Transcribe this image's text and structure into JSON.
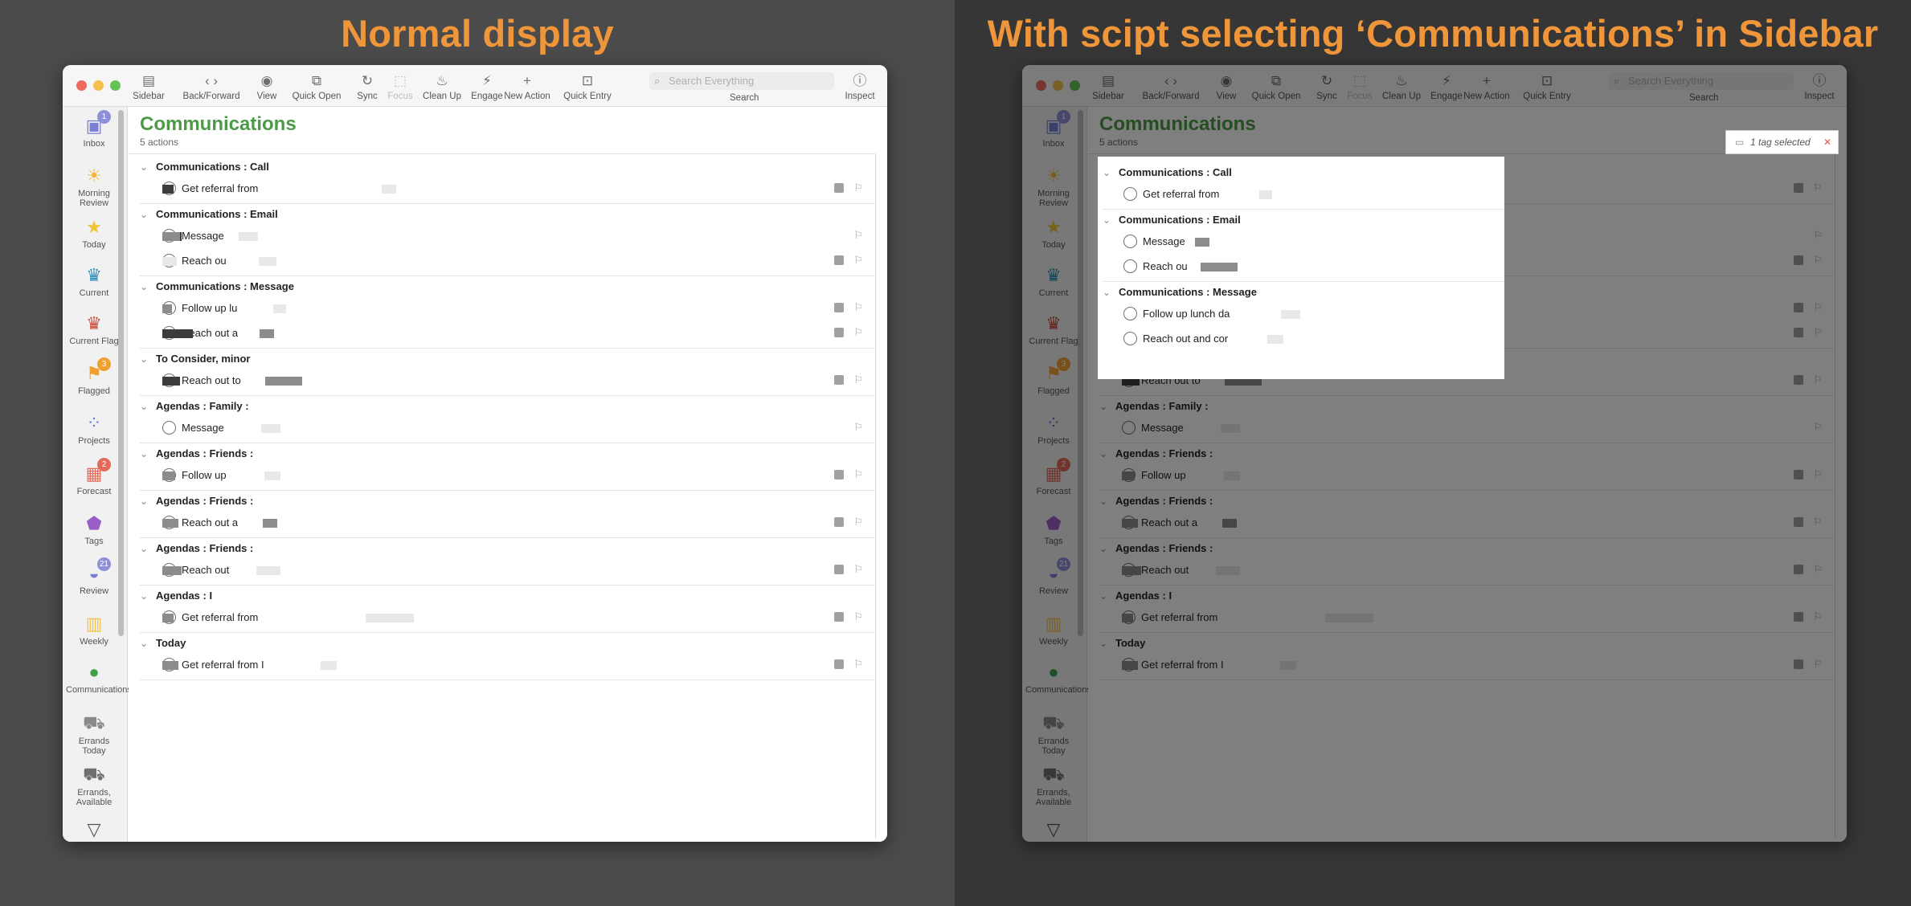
{
  "headings": {
    "left": "Normal display",
    "right": "With scipt selecting ‘Communications’ in Sidebar"
  },
  "toolbar": {
    "items": [
      {
        "label": "Sidebar",
        "icon": "sidebar-icon",
        "glyph": "▤"
      },
      {
        "label": "Back/Forward",
        "icon": "back-forward-icon",
        "glyph": "‹  ›"
      },
      {
        "label": "View",
        "icon": "eye-icon",
        "glyph": "◉"
      },
      {
        "label": "Quick Open",
        "icon": "quick-open-icon",
        "glyph": "⧉"
      },
      {
        "label": "Sync",
        "icon": "sync-icon",
        "glyph": "↻"
      },
      {
        "label": "Focus",
        "icon": "focus-icon",
        "glyph": "⬚"
      },
      {
        "label": "Clean Up",
        "icon": "clean-up-icon",
        "glyph": "♨"
      },
      {
        "label": "Engage",
        "icon": "engage-icon",
        "glyph": "⚡"
      },
      {
        "label": "New Action",
        "icon": "plus-icon",
        "glyph": "+"
      },
      {
        "label": "Quick Entry",
        "icon": "tray-icon",
        "glyph": "⊡"
      },
      {
        "label": "Inspect",
        "icon": "info-icon",
        "glyph": "ⓘ"
      }
    ],
    "search_placeholder": "Search Everything",
    "search_label": "Search"
  },
  "sidebar": {
    "items": [
      {
        "label": "Inbox",
        "icon": "inbox-icon",
        "glyph": "▣",
        "color": "#7a7fd6",
        "badge": "1",
        "badge_color": "#8d8fd9"
      },
      {
        "label": "Morning Review",
        "icon": "sunrise-icon",
        "glyph": "☀",
        "color": "#f3b83a",
        "badge": "",
        "badge_color": ""
      },
      {
        "label": "Today",
        "icon": "star-icon",
        "glyph": "★",
        "color": "#f1c232",
        "badge": "",
        "badge_color": ""
      },
      {
        "label": "Current",
        "icon": "current-icon",
        "glyph": "♛",
        "color": "#2f8fb7",
        "badge": "",
        "badge_color": ""
      },
      {
        "label": "Current Flag",
        "icon": "flag-crown-icon",
        "glyph": "♛",
        "color": "#c94b3b",
        "badge": "",
        "badge_color": ""
      },
      {
        "label": "Flagged",
        "icon": "flag-icon",
        "glyph": "⚑",
        "color": "#f0a033",
        "badge": "3",
        "badge_color": "#f0a033"
      },
      {
        "label": "Projects",
        "icon": "projects-icon",
        "glyph": "⁘",
        "color": "#4b7bd4",
        "badge": "",
        "badge_color": ""
      },
      {
        "label": "Forecast",
        "icon": "forecast-icon",
        "glyph": "▦",
        "color": "#e46b5a",
        "badge": "2",
        "badge_color": "#e46b5a"
      },
      {
        "label": "Tags",
        "icon": "tag-icon",
        "glyph": "⬟",
        "color": "#9a5ec8",
        "badge": "",
        "badge_color": ""
      },
      {
        "label": "Review",
        "icon": "review-icon",
        "glyph": "◒",
        "color": "#7a7fd6",
        "badge": "21",
        "badge_color": "#8d8fd9"
      },
      {
        "label": "Weekly",
        "icon": "calendar-icon",
        "glyph": "▥",
        "color": "#f3c24a",
        "badge": "",
        "badge_color": ""
      },
      {
        "label": "Communications",
        "icon": "speech-bubble-icon",
        "glyph": "●",
        "color": "#3ea04a",
        "badge": "",
        "badge_color": ""
      },
      {
        "label": "Errands Today",
        "icon": "car-icon",
        "glyph": "⛟",
        "color": "#8a8a8a",
        "badge": "",
        "badge_color": ""
      },
      {
        "label": "Errands, Available",
        "icon": "car-icon",
        "glyph": "⛟",
        "color": "#6f6f6f",
        "badge": "",
        "badge_color": ""
      },
      {
        "label": "",
        "icon": "filter-icon",
        "glyph": "▽",
        "color": "#555555",
        "badge": "",
        "badge_color": ""
      }
    ]
  },
  "perspective": {
    "title": "Communications",
    "subtitle": "5 actions"
  },
  "groups": [
    {
      "header": "Communications : Call",
      "rows": [
        {
          "text": "Get referral from",
          "note": true
        }
      ]
    },
    {
      "header": "Communications : Email",
      "rows": [
        {
          "text": "Message",
          "note": false
        },
        {
          "text": "Reach ou",
          "note": true
        }
      ]
    },
    {
      "header": "Communications : Message",
      "rows": [
        {
          "text": "Follow up lu",
          "note": true
        },
        {
          "text": "Reach out a",
          "note": true
        }
      ]
    },
    {
      "header": "To Consider, minor",
      "rows": [
        {
          "text": "Reach out to",
          "note": true
        }
      ]
    },
    {
      "header": "Agendas : Family :",
      "rows": [
        {
          "text": "Message",
          "note": false
        }
      ]
    },
    {
      "header": "Agendas : Friends :",
      "rows": [
        {
          "text": "Follow up",
          "note": true
        }
      ]
    },
    {
      "header": "Agendas : Friends :",
      "rows": [
        {
          "text": "Reach out a",
          "note": true
        }
      ]
    },
    {
      "header": "Agendas : Friends :",
      "rows": [
        {
          "text": "Reach out",
          "note": true
        }
      ]
    },
    {
      "header": "Agendas : I",
      "rows": [
        {
          "text": "Get referral from",
          "note": true
        }
      ]
    },
    {
      "header": "Today",
      "rows": [
        {
          "text": "Get referral from I",
          "note": true
        }
      ]
    }
  ],
  "right_rows": [
    "Get referral from",
    "Message",
    "Reach ou",
    "Follow up lunch da",
    "Reach out and cor"
  ],
  "tag_chip": "1 tag selected",
  "colors": {
    "heading": "#f0963a",
    "title_green": "#4c9a45"
  }
}
